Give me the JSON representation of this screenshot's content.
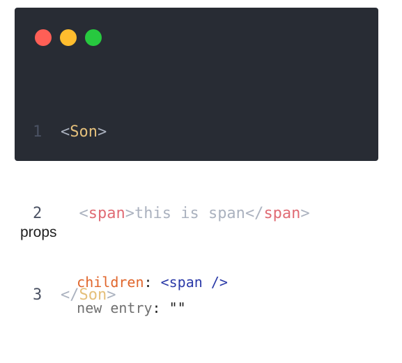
{
  "window_controls": {
    "close_color": "#ff5f56",
    "minimize_color": "#ffbd2e",
    "maximize_color": "#27c93f"
  },
  "code": {
    "lines": [
      {
        "number": "1",
        "open": "<",
        "tag": "Son",
        "close": ">"
      },
      {
        "number": "2",
        "open": "<",
        "tag": "span",
        "close": ">",
        "text": "this is span",
        "end_open": "</",
        "end_tag": "span",
        "end_close": ">"
      },
      {
        "number": "3",
        "open": "</",
        "tag": "Son",
        "close": ">"
      }
    ]
  },
  "props": {
    "title": "props",
    "entries": [
      {
        "key": "children",
        "colon": ":",
        "value": "<span />"
      },
      {
        "key": "new entry",
        "colon": ":",
        "value": "\"\""
      }
    ]
  }
}
